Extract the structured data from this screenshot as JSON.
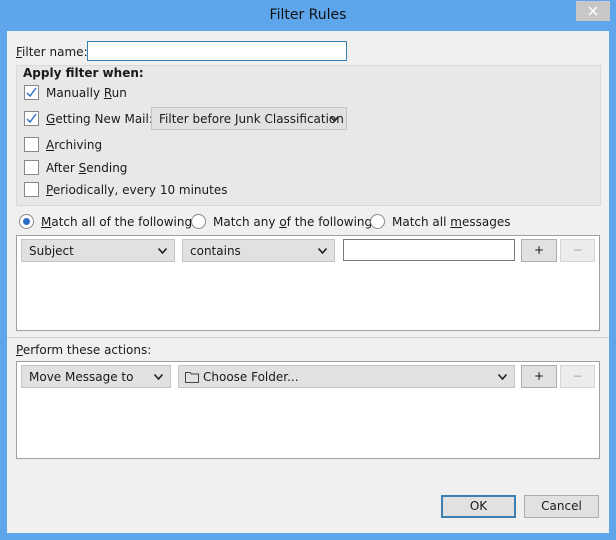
{
  "window": {
    "title": "Filter Rules"
  },
  "filter_name": {
    "label_u": "F",
    "label_rest": "ilter name:",
    "value": ""
  },
  "apply_when": {
    "heading": "Apply filter when:",
    "manual": {
      "pre": "Manually ",
      "u": "R",
      "post": "un",
      "checked": true
    },
    "new_mail": {
      "pre": "",
      "u": "G",
      "post": "etting New Mail:",
      "checked": true
    },
    "junk_option": "Filter before Junk Classification",
    "archiving": {
      "pre": "",
      "u": "A",
      "post": "rchiving",
      "checked": false
    },
    "after_sending": {
      "pre": "After ",
      "u": "S",
      "post": "ending",
      "checked": false
    },
    "periodically": {
      "pre": "",
      "u": "P",
      "post": "eriodically, every 10 minutes",
      "checked": false
    }
  },
  "match": {
    "all": {
      "pre": "",
      "u": "M",
      "post": "atch all of the following",
      "selected": true
    },
    "any": {
      "pre": "Match any ",
      "u": "o",
      "post": "f the following",
      "selected": false
    },
    "messages": {
      "pre": "Match all ",
      "u": "m",
      "post": "essages",
      "selected": false
    }
  },
  "condition": {
    "field": "Subject",
    "operator": "contains",
    "value": "",
    "add": "+",
    "remove": "−"
  },
  "actions": {
    "heading_u": "P",
    "heading_rest": "erform these actions:",
    "action": "Move Message to",
    "folder": "Choose Folder...",
    "add": "+",
    "remove": "−"
  },
  "buttons": {
    "ok": "OK",
    "cancel": "Cancel"
  },
  "icons": {
    "close": "close-icon",
    "check": "check-icon",
    "chevron": "chevron-down-icon",
    "folder": "folder-icon"
  }
}
